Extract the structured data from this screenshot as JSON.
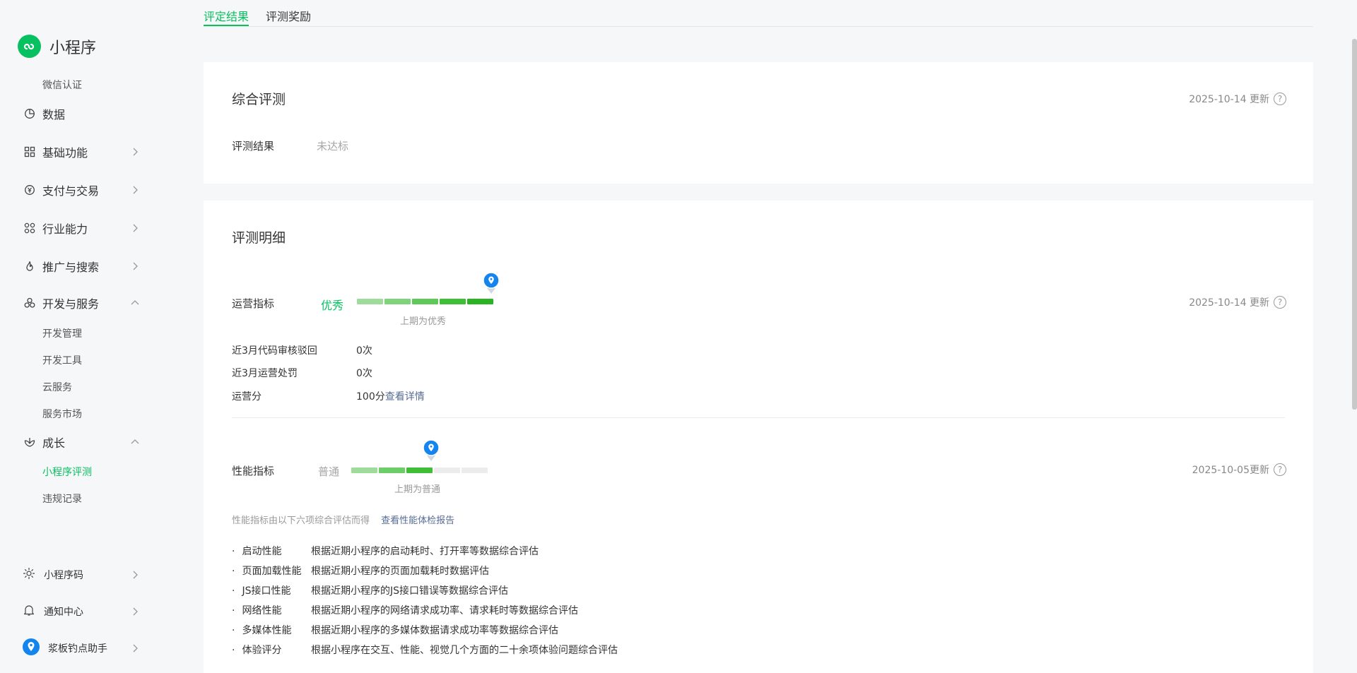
{
  "app": {
    "title": "小程序"
  },
  "sidebar": {
    "top_sub": "微信认证",
    "items": [
      {
        "label": "数据"
      },
      {
        "label": "基础功能"
      },
      {
        "label": "支付与交易"
      },
      {
        "label": "行业能力"
      },
      {
        "label": "推广与搜索"
      },
      {
        "label": "开发与服务"
      }
    ],
    "dev_sub": [
      "开发管理",
      "开发工具",
      "云服务",
      "服务市场"
    ],
    "growth": {
      "label": "成长"
    },
    "growth_sub": [
      "小程序评测",
      "违规记录"
    ],
    "bottom": [
      {
        "label": "小程序码"
      },
      {
        "label": "通知中心"
      },
      {
        "label": "浆板钓点助手"
      }
    ]
  },
  "tabs": [
    "评定结果",
    "评测奖励"
  ],
  "summary": {
    "title": "综合评测",
    "updated": "2025-10-14 更新",
    "result_label": "评测结果",
    "result_value": "未达标"
  },
  "detail": {
    "title": "评测明细",
    "ops": {
      "label": "运营指标",
      "level": "优秀",
      "prev_note": "上期为优秀",
      "updated": "2025-10-14 更新",
      "level_fraction": 1.0,
      "rows": [
        {
          "label": "近3月代码审核驳回",
          "value": "0次"
        },
        {
          "label": "近3月运营处罚",
          "value": "0次"
        },
        {
          "label": "运营分",
          "value": "100分",
          "link": "查看详情"
        }
      ]
    },
    "perf": {
      "label": "性能指标",
      "level": "普通",
      "prev_note": "上期为普通",
      "updated": "2025-10-05更新",
      "level_fraction": 0.6,
      "intro": "性能指标由以下六项综合评估而得",
      "intro_link": "查看性能体检报告",
      "items": [
        {
          "name": "启动性能",
          "desc": "根据近期小程序的启动耗时、打开率等数据综合评估"
        },
        {
          "name": "页面加载性能",
          "desc": "根据近期小程序的页面加载耗时数据评估"
        },
        {
          "name": "JS接口性能",
          "desc": "根据近期小程序的JS接口错误等数据综合评估"
        },
        {
          "name": "网络性能",
          "desc": "根据近期小程序的网络请求成功率、请求耗时等数据综合评估"
        },
        {
          "name": "多媒体性能",
          "desc": "根据近期小程序的多媒体数据请求成功率等数据综合评估"
        },
        {
          "name": "体验评分",
          "desc": "根据小程序在交互、性能、视觉几个方面的二十余项体验问题综合评估"
        }
      ]
    }
  },
  "colors": {
    "accent": "#07c160",
    "link": "#576b95",
    "pin": "#1485ee"
  }
}
